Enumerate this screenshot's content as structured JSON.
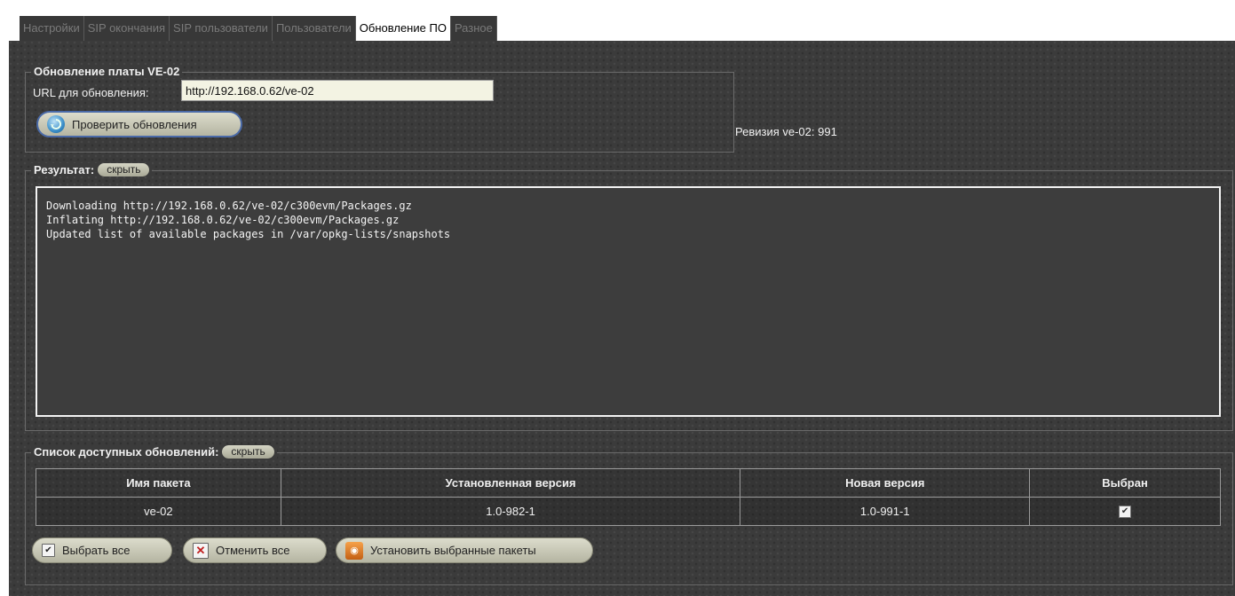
{
  "tabs": [
    {
      "label": "Настройки",
      "active": false
    },
    {
      "label": "SIP окончания",
      "active": false
    },
    {
      "label": "SIP пользователи",
      "active": false
    },
    {
      "label": "Пользователи",
      "active": false
    },
    {
      "label": "Обновление ПО",
      "active": true
    },
    {
      "label": "Разное",
      "active": false
    }
  ],
  "update_board": {
    "legend": "Обновление платы VE-02",
    "url_label": "URL для обновления:",
    "url_value": "http://192.168.0.62/ve-02",
    "check_button": "Проверить обновления",
    "check_icon": "refresh-globe-icon",
    "revision_text": "Ревизия ve-02: 991"
  },
  "result": {
    "legend": "Результат:",
    "toggle_label": "скрыть",
    "log_text": "Downloading http://192.168.0.62/ve-02/c300evm/Packages.gz\nInflating http://192.168.0.62/ve-02/c300evm/Packages.gz\nUpdated list of available packages in /var/opkg-lists/snapshots"
  },
  "updates": {
    "legend": "Список доступных обновлений:",
    "toggle_label": "скрыть",
    "columns": [
      "Имя пакета",
      "Установленная версия",
      "Новая версия",
      "Выбран"
    ],
    "rows": [
      {
        "name": "ve-02",
        "installed": "1.0-982-1",
        "new": "1.0-991-1",
        "selected": true
      }
    ],
    "select_all": "Выбрать все",
    "cancel_all": "Отменить все",
    "install": "Установить выбранные пакеты"
  },
  "colors": {
    "panel_bg": "#3b3b3b",
    "active_tab_bg": "#ffffff",
    "check_button_border": "#4a6aa8"
  }
}
